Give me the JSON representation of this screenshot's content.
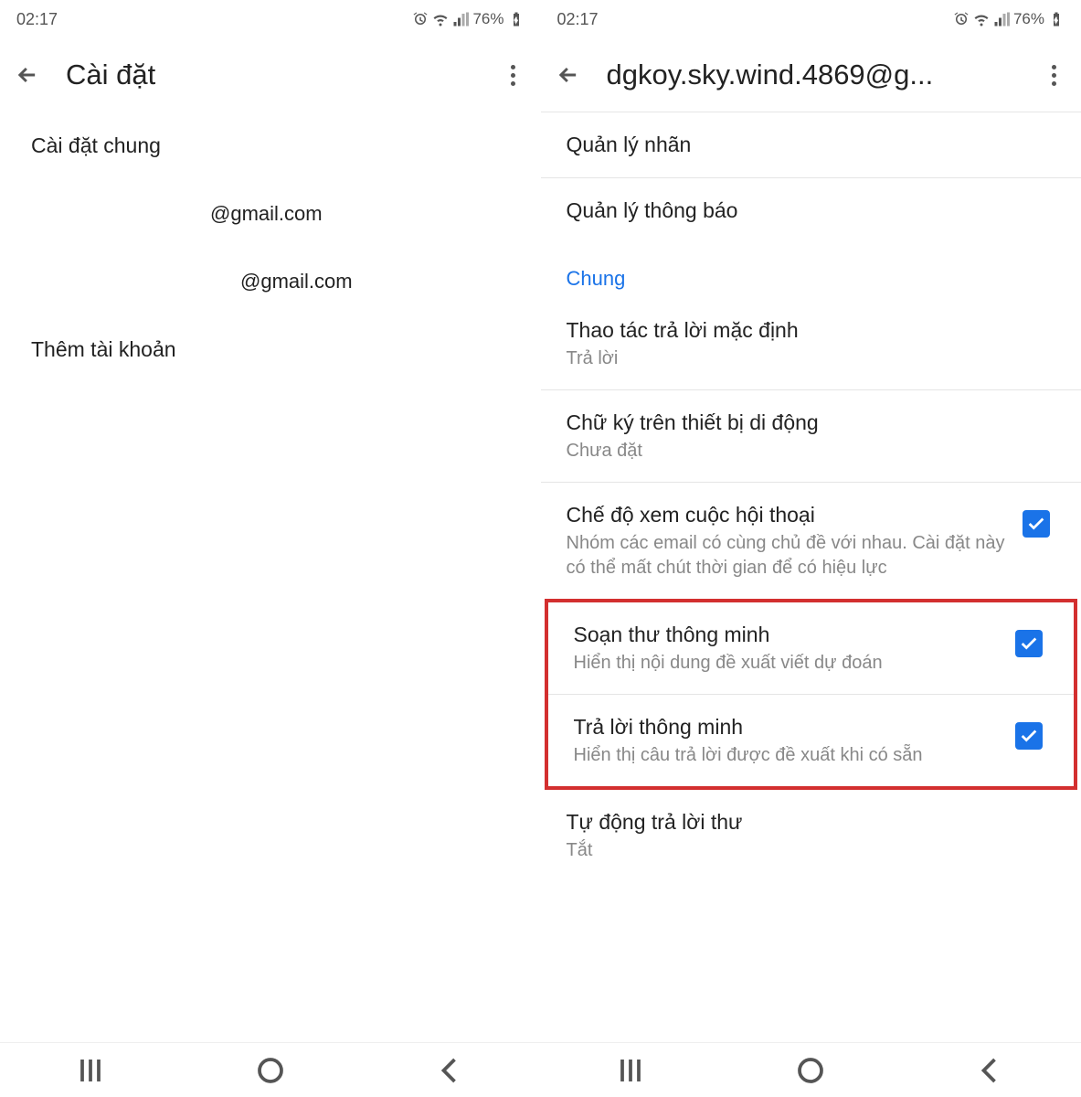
{
  "status_bar": {
    "time": "02:17",
    "battery": "76%"
  },
  "screen_left": {
    "title": "Cài đặt",
    "items": {
      "general": "Cài đặt chung",
      "account1": "@gmail.com",
      "account2": "@gmail.com",
      "add_account": "Thêm tài khoản"
    }
  },
  "screen_right": {
    "title": "dgkoy.sky.wind.4869@g...",
    "rows": {
      "manage_labels": "Quản lý nhãn",
      "manage_notifications": "Quản lý thông báo",
      "section_general": "Chung",
      "default_reply": {
        "title": "Thao tác trả lời mặc định",
        "sub": "Trả lời"
      },
      "signature": {
        "title": "Chữ ký trên thiết bị di động",
        "sub": "Chưa đặt"
      },
      "conversation": {
        "title": "Chế độ xem cuộc hội thoại",
        "sub": "Nhóm các email có cùng chủ đề với nhau. Cài đặt này có thể mất chút thời gian để có hiệu lực"
      },
      "smart_compose": {
        "title": "Soạn thư thông minh",
        "sub": "Hiển thị nội dung đề xuất viết dự đoán"
      },
      "smart_reply": {
        "title": "Trả lời thông minh",
        "sub": "Hiển thị câu trả lời được đề xuất khi có sẵn"
      },
      "auto_reply": {
        "title": "Tự động trả lời thư",
        "sub": "Tắt"
      }
    }
  }
}
